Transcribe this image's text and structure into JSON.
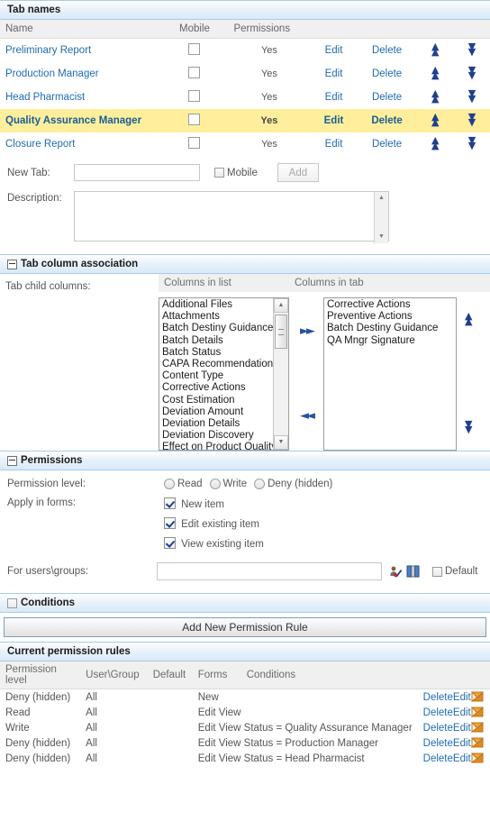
{
  "tab_names": {
    "section_title": "Tab names",
    "columns": [
      "Name",
      "Mobile",
      "Permissions"
    ],
    "rows": [
      {
        "name": "Preliminary Report",
        "mobile": false,
        "permissions": "Yes",
        "edit": "Edit",
        "delete": "Delete",
        "highlighted": false
      },
      {
        "name": "Production Manager",
        "mobile": false,
        "permissions": "Yes",
        "edit": "Edit",
        "delete": "Delete",
        "highlighted": false
      },
      {
        "name": "Head Pharmacist",
        "mobile": false,
        "permissions": "Yes",
        "edit": "Edit",
        "delete": "Delete",
        "highlighted": false
      },
      {
        "name": "Quality Assurance Manager",
        "mobile": false,
        "permissions": "Yes",
        "edit": "Edit",
        "delete": "Delete",
        "highlighted": true
      },
      {
        "name": "Closure Report",
        "mobile": false,
        "permissions": "Yes",
        "edit": "Edit",
        "delete": "Delete",
        "highlighted": false
      }
    ],
    "new_tab_label": "New Tab:",
    "new_tab_value": "",
    "mobile_label": "Mobile",
    "add_label": "Add",
    "description_label": "Description:",
    "description_value": ""
  },
  "tab_column_association": {
    "section_title": "Tab column association",
    "child_columns_label": "Tab child columns:",
    "columns_in_list_label": "Columns in list",
    "columns_in_tab_label": "Columns in tab",
    "columns_in_list": [
      "Additional Files",
      "Attachments",
      "Batch Destiny Guidance",
      "Batch Details",
      "Batch Status",
      "CAPA Recommendations",
      "Content Type",
      "Corrective Actions",
      "Cost Estimation",
      "Deviation Amount",
      "Deviation Details",
      "Deviation Discovery",
      "Effect on Product Quality"
    ],
    "columns_in_tab": [
      "Corrective Actions",
      "Preventive Actions",
      "Batch Destiny Guidance",
      "QA Mngr Signature"
    ],
    "move_right_icon": "double-right-arrow-icon",
    "move_left_icon": "double-left-arrow-icon",
    "move_up_icon": "double-up-chevron-icon",
    "move_down_icon": "double-down-chevron-icon"
  },
  "permissions": {
    "section_title": "Permissions",
    "permission_level_label": "Permission level:",
    "permission_levels": [
      "Read",
      "Write",
      "Deny (hidden)"
    ],
    "permission_level_selected": "",
    "apply_in_forms_label": "Apply in forms:",
    "forms": [
      {
        "label": "New item",
        "checked": true
      },
      {
        "label": "Edit existing item",
        "checked": true
      },
      {
        "label": "View existing item",
        "checked": true
      }
    ],
    "users_groups_label": "For users\\groups:",
    "users_groups_value": "",
    "check_names_icon": "check-names-icon",
    "address_book_icon": "address-book-icon",
    "default_label": "Default",
    "default_checked": false,
    "conditions_title": "Conditions",
    "conditions_checked": false,
    "add_rule_label": "Add New Permission Rule"
  },
  "current_rules": {
    "section_title": "Current permission rules",
    "columns": [
      "Permission level",
      "User\\Group",
      "Default",
      "Forms",
      "Conditions"
    ],
    "rows": [
      {
        "level": "Deny (hidden)",
        "user_group": "All",
        "default": "",
        "forms": "New",
        "conditions": "",
        "delete": "Delete",
        "edit": "Edit",
        "icon": "edit-pencil-icon"
      },
      {
        "level": "Read",
        "user_group": "All",
        "default": "",
        "forms": "Edit View",
        "conditions": "",
        "delete": "Delete",
        "edit": "Edit",
        "icon": "edit-pencil-icon"
      },
      {
        "level": "Write",
        "user_group": "All",
        "default": "",
        "forms": "Edit View Status = Quality Assurance Manager",
        "conditions": "",
        "delete": "Delete",
        "edit": "Edit",
        "icon": "edit-pencil-icon"
      },
      {
        "level": "Deny (hidden)",
        "user_group": "All",
        "default": "",
        "forms": "Edit View Status = Production Manager",
        "conditions": "",
        "delete": "Delete",
        "edit": "Edit",
        "icon": "edit-pencil-icon"
      },
      {
        "level": "Deny (hidden)",
        "user_group": "All",
        "default": "",
        "forms": "Edit View Status = Head Pharmacist",
        "conditions": "",
        "delete": "Delete",
        "edit": "Edit",
        "icon": "edit-pencil-icon"
      }
    ]
  },
  "colors": {
    "section_bar": "#d9eaf8",
    "link": "#1f6cb0",
    "highlight_row": "#ffef9c",
    "chevron": "#1f3f8f",
    "icon_orange": "#e8871e"
  }
}
